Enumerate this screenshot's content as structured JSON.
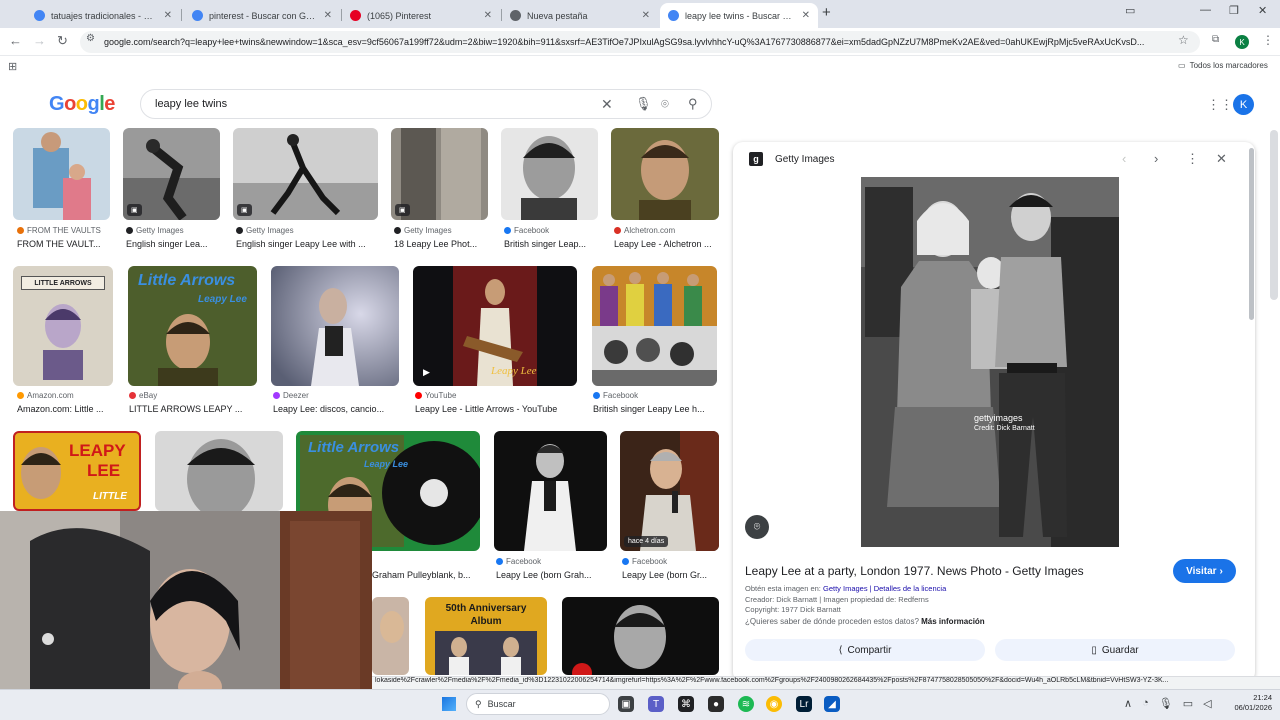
{
  "browser": {
    "tabs": [
      {
        "title": "tatuajes tradicionales - Buscar",
        "color": "#4285f4"
      },
      {
        "title": "pinterest - Buscar con Google",
        "color": "#4285f4"
      },
      {
        "title": "(1065) Pinterest",
        "color": "#e60023"
      },
      {
        "title": "Nueva pestaña",
        "color": "#5f6368"
      },
      {
        "title": "leapy lee twins - Buscar con Go",
        "color": "#4285f4"
      }
    ],
    "url": "google.com/search?q=leapy+lee+twins&newwindow=1&sca_esv=9cf56067a199ff72&udm=2&biw=1920&bih=911&sxsrf=AE3TifOe7JPIxulAgSG9sa.lyvlvhhcY-uQ%3A1767730886877&ei=xm5dadGpNZzU7M8PmeKv2AE&ved=0ahUKEwjRpMjc5veRAxUcKvsD...",
    "bookmarks_all": "Todos los marcadores",
    "profile_initial": "K"
  },
  "google": {
    "logo": "Google",
    "query": "leapy lee twins",
    "avatar": "K"
  },
  "results": {
    "row1": [
      {
        "source": "FROM THE VAULTS",
        "title": "FROM THE VAULT...",
        "dot": "#e8710a"
      },
      {
        "source": "Getty Images",
        "title": "English singer Lea...",
        "dot": "#202124"
      },
      {
        "source": "Getty Images",
        "title": "English singer Leapy Lee with ...",
        "dot": "#202124"
      },
      {
        "source": "Getty Images",
        "title": "18 Leapy Lee Phot...",
        "dot": "#202124"
      },
      {
        "source": "Facebook",
        "title": "British singer Leap...",
        "dot": "#1877f2"
      },
      {
        "source": "Alchetron.com",
        "title": "Leapy Lee - Alchetron ...",
        "dot": "#d93025"
      }
    ],
    "row2": [
      {
        "source": "Amazon.com",
        "title": "Amazon.com: Little ...",
        "dot": "#ff9900"
      },
      {
        "source": "eBay",
        "title": "LITTLE ARROWS LEAPY ...",
        "dot": "#e53238"
      },
      {
        "source": "Deezer",
        "title": "Leapy Lee: discos, cancio...",
        "dot": "#a238ff"
      },
      {
        "source": "YouTube",
        "title": "Leapy Lee - Little Arrows - YouTube",
        "dot": "#ff0000"
      },
      {
        "source": "Facebook",
        "title": "British singer Leapy Lee h...",
        "dot": "#1877f2"
      }
    ],
    "row3": [
      {
        "source": "",
        "title": "Graham Pulleyblank, b...",
        "dot": "#ffffff"
      },
      {
        "source": "Facebook",
        "title": "Leapy Lee (born Grah...",
        "dot": "#1877f2"
      },
      {
        "source": "Facebook",
        "title": "Leapy Lee (born Gr...",
        "dot": "#1877f2"
      }
    ],
    "cover_text": {
      "little_arrows": "LITTLE ARROWS",
      "little_arrows_script": "Little Arrows",
      "leapy_lee_script": "Leapy Lee",
      "leapy": "LEAPY",
      "lee": "LEE",
      "little": "LITTLE",
      "anniversary": "50th Anniversary",
      "album": "Album",
      "recent_badge": "hace 4 días"
    }
  },
  "panel": {
    "source": "Getty Images",
    "logo_letter": "g",
    "watermark": "gettyimages",
    "credit_overlay": "Credit: Dick Barnatt",
    "title": "Leapy Lee at a party, London 1977. News Photo - Getty Images",
    "visit": "Visitar",
    "meta1_label": "Obtén esta imagen en:",
    "meta1_link": "Getty Images | Detalles de la licencia",
    "meta2": "Creador: Dick Barnatt | Imagen propiedad de: Redferns",
    "meta3": "Copyright: 1977 Dick Barnatt",
    "question": "¿Quieres saber de dónde proceden estos datos?",
    "more_info": "Más información",
    "share": "Compartir",
    "save": "Guardar"
  },
  "status_url": "lokaside%2Fcrawler%2Fmedia%2F%2Fmedia_id%3D12231022006254714&imgrefurl=https%3A%2F%2Fwww.facebook.com%2Fgroups%2F2400980262684435%2Fposts%2F8747758028505050%2F&docid=Wu4h_aOLRb5cLM&tbnid=VvHtSW3-YZ-3K...",
  "taskbar": {
    "search": "Buscar",
    "time": "21:24",
    "date": "06/01/2026"
  }
}
